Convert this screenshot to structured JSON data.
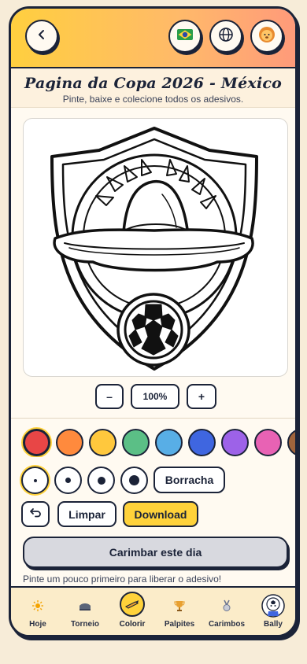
{
  "header": {
    "back_icon": "chevron-left-icon",
    "flag_icon": "brazil-flag-icon",
    "globe_icon": "globe-icon",
    "mascot_icon": "lion-mascot-icon"
  },
  "page": {
    "title": "Pagina da Copa 2026 - México",
    "subtitle": "Pinte, baixe e colecione todos os adesivos."
  },
  "canvas": {
    "artwork": "crest-sombrero-soccer-ball-outline"
  },
  "zoom": {
    "minus_label": "–",
    "level": "100%",
    "plus_label": "+"
  },
  "palette": {
    "colors": [
      "#e84646",
      "#ff8a3d",
      "#ffc83d",
      "#5bbf86",
      "#58aee6",
      "#3f66e0",
      "#9d62e8",
      "#e862b4",
      "#a0643c"
    ],
    "selected_index": 0
  },
  "brush": {
    "sizes": [
      "small",
      "medium",
      "large",
      "xlarge"
    ],
    "selected_index": 0,
    "eraser_label": "Borracha"
  },
  "actions": {
    "undo_icon": "undo-icon",
    "clear_label": "Limpar",
    "download_label": "Download"
  },
  "stamp": {
    "button_label": "Carimbar este dia",
    "hint": "Pinte um pouco primeiro para liberar o adesivo!"
  },
  "nav": {
    "items": [
      {
        "label": "Hoje",
        "icon": "sun-icon"
      },
      {
        "label": "Torneio",
        "icon": "stadium-icon"
      },
      {
        "label": "Colorir",
        "icon": "crayon-icon",
        "active": true
      },
      {
        "label": "Palpites",
        "icon": "trophy-icon"
      },
      {
        "label": "Carimbos",
        "icon": "medal-icon"
      },
      {
        "label": "Bally",
        "icon": "bally-mascot-icon"
      }
    ]
  }
}
